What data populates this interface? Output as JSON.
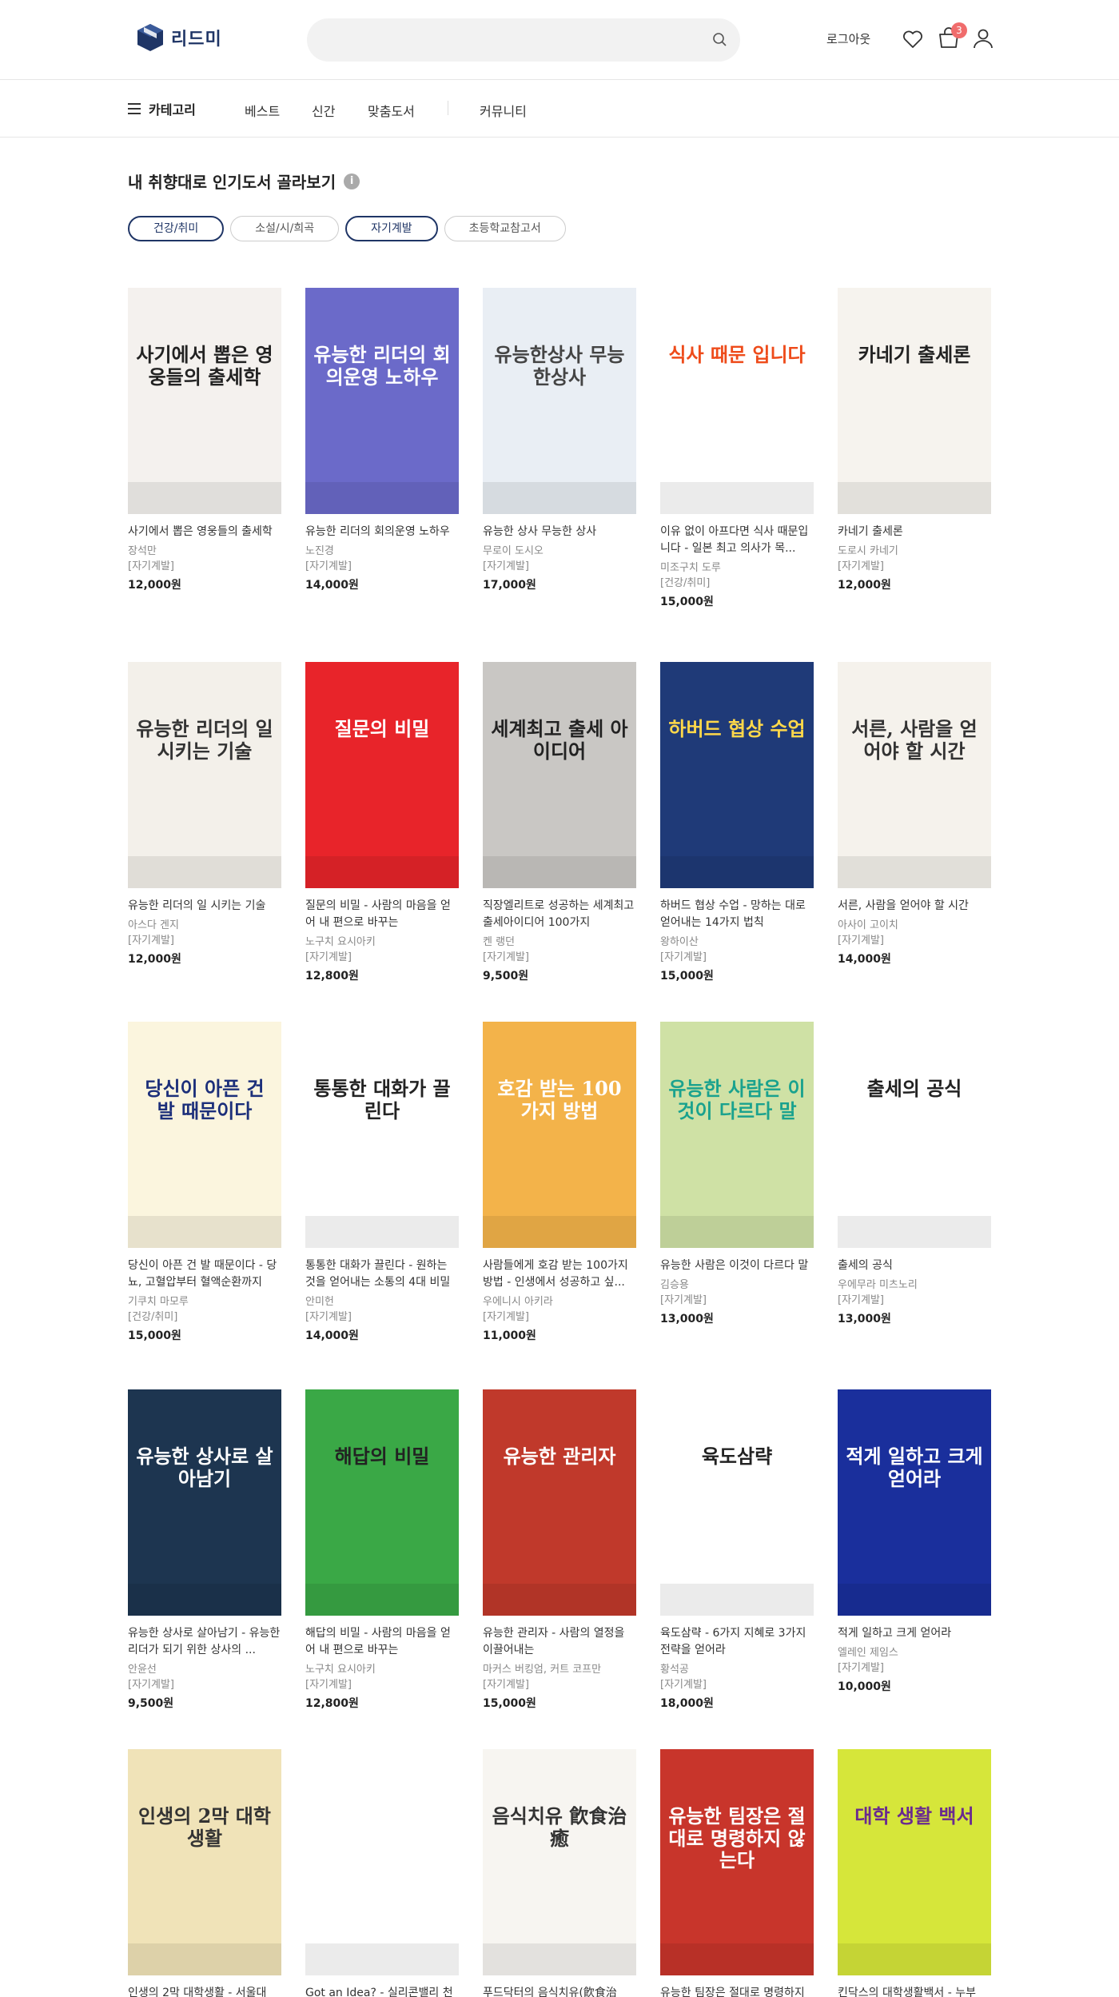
{
  "header": {
    "logo_text": "리드미",
    "search_placeholder": "",
    "login_label": "로그아웃",
    "cart_count": "3"
  },
  "nav": {
    "category_label": "카테고리",
    "links": [
      "베스트",
      "신간",
      "맞춤도서",
      "커뮤니티"
    ]
  },
  "section": {
    "title": "내 취향대로 인기도서 골라보기",
    "info_icon": "i",
    "filters": [
      {
        "label": "건강/취미",
        "active": true
      },
      {
        "label": "소설/시/희곡",
        "active": false
      },
      {
        "label": "자기계발",
        "active": true
      },
      {
        "label": "초등학교참고서",
        "active": false
      }
    ]
  },
  "books": [
    {
      "title": "사기에서 뽑은 영웅들의 출세학",
      "author": "장석만",
      "genre": "[자기계발]",
      "price": "12,000원",
      "cover_text": "사기에서 뽑은 영웅들의 출세학",
      "cover_bg": "#f4f1ee",
      "cover_fg": "#222222"
    },
    {
      "title": "유능한 리더의 회의운영 노하우",
      "author": "노진경",
      "genre": "[자기계발]",
      "price": "14,000원",
      "cover_text": "유능한 리더의 회의운영 노하우",
      "cover_bg": "#6b6ac9",
      "cover_fg": "#ffffff"
    },
    {
      "title": "유능한 상사 무능한 상사",
      "author": "무로이 도시오",
      "genre": "[자기계발]",
      "price": "17,000원",
      "cover_text": "유능한상사 무능한상사",
      "cover_bg": "#e9eef4",
      "cover_fg": "#444444"
    },
    {
      "title": "이유 없이 아프다면 식사 때문입니다 - 일본 최고 의사가 목...",
      "author": "미조구치 도루",
      "genre": "[건강/취미]",
      "price": "15,000원",
      "cover_text": "식사 때문 입니다",
      "cover_bg": "#ffffff",
      "cover_fg": "#ee4b1a"
    },
    {
      "title": "카네기 출세론",
      "author": "도로시 카네기",
      "genre": "[자기계발]",
      "price": "12,000원",
      "cover_text": "카네기 출세론",
      "cover_bg": "#f6f3ee",
      "cover_fg": "#222222"
    },
    {
      "title": "유능한 리더의 일 시키는 기술",
      "author": "아스다 겐지",
      "genre": "[자기계발]",
      "price": "12,000원",
      "cover_text": "유능한 리더의 일 시키는 기술",
      "cover_bg": "#f3f0ea",
      "cover_fg": "#333333"
    },
    {
      "title": "질문의 비밀 - 사람의 마음을 얻어 내 편으로 바꾸는",
      "author": "노구치 요시아키",
      "genre": "[자기계발]",
      "price": "12,800원",
      "cover_text": "질문의 비밀",
      "cover_bg": "#e8242a",
      "cover_fg": "#ffffff"
    },
    {
      "title": "직장엘리트로 성공하는 세계최고 출세아이디어 100가지",
      "author": "켄 랭던",
      "genre": "[자기계발]",
      "price": "9,500원",
      "cover_text": "세계최고 출세 아이디어",
      "cover_bg": "#c9c7c4",
      "cover_fg": "#222222"
    },
    {
      "title": "하버드 협상 수업 - 망하는 대로 얻어내는 14가지 법칙",
      "author": "왕하이산",
      "genre": "[자기계발]",
      "price": "15,000원",
      "cover_text": "하버드 협상 수업",
      "cover_bg": "#1f3a78",
      "cover_fg": "#ffd84a"
    },
    {
      "title": "서른, 사람을 얻어야 할 시간",
      "author": "아사이 고이치",
      "genre": "[자기계발]",
      "price": "14,000원",
      "cover_text": "서른, 사람을 얻어야 할 시간",
      "cover_bg": "#f5f2ec",
      "cover_fg": "#333333"
    },
    {
      "title": "당신이 아픈 건 발 때문이다 - 당뇨, 고혈압부터 혈액순환까지",
      "author": "기쿠치 마모루",
      "genre": "[건강/취미]",
      "price": "15,000원",
      "cover_text": "당신이 아픈 건 발 때문이다",
      "cover_bg": "#fbf5de",
      "cover_fg": "#1c2f7a"
    },
    {
      "title": "통통한 대화가 끌린다 - 원하는 것을 얻어내는 소통의 4대 비밀",
      "author": "안미헌",
      "genre": "[자기계발]",
      "price": "14,000원",
      "cover_text": "통통한 대화가 끌린다",
      "cover_bg": "#ffffff",
      "cover_fg": "#222222"
    },
    {
      "title": "사람들에게 호감 받는 100가지 방법 - 인생에서 성공하고 싶...",
      "author": "우에니시 아키라",
      "genre": "[자기계발]",
      "price": "11,000원",
      "cover_text": "호감 받는 100가지 방법",
      "cover_bg": "#f3b34a",
      "cover_fg": "#ffffff"
    },
    {
      "title": "유능한 사람은 이것이 다르다 말",
      "author": "김승용",
      "genre": "[자기계발]",
      "price": "13,000원",
      "cover_text": "유능한 사람은 이것이 다르다 말",
      "cover_bg": "#cfe1a5",
      "cover_fg": "#1aa28e"
    },
    {
      "title": "출세의 공식",
      "author": "우에무라 미츠노리",
      "genre": "[자기계발]",
      "price": "13,000원",
      "cover_text": "출세의 공식",
      "cover_bg": "#ffffff",
      "cover_fg": "#222222"
    },
    {
      "title": "유능한 상사로 살아남기 - 유능한 리더가 되기 위한 상사의 ...",
      "author": "안윤선",
      "genre": "[자기계발]",
      "price": "9,500원",
      "cover_text": "유능한 상사로 살아남기",
      "cover_bg": "#1d3550",
      "cover_fg": "#ffffff"
    },
    {
      "title": "해답의 비밀 - 사람의 마음을 얻어 내 편으로 바꾸는",
      "author": "노구치 요시아키",
      "genre": "[자기계발]",
      "price": "12,800원",
      "cover_text": "해답의 비밀",
      "cover_bg": "#3aa846",
      "cover_fg": "#222222"
    },
    {
      "title": "유능한 관리자 - 사람의 열정을 이끌어내는",
      "author": "마커스 버킹엄, 커트 코프만",
      "genre": "[자기계발]",
      "price": "15,000원",
      "cover_text": "유능한 관리자",
      "cover_bg": "#c0392b",
      "cover_fg": "#ffffff"
    },
    {
      "title": "육도삼략 - 6가지 지혜로 3가지 전략을 얻어라",
      "author": "황석공",
      "genre": "[자기계발]",
      "price": "18,000원",
      "cover_text": "육도삼략",
      "cover_bg": "#ffffff",
      "cover_fg": "#222222"
    },
    {
      "title": "적게 일하고 크게 얻어라",
      "author": "엘레인 제임스",
      "genre": "[자기계발]",
      "price": "10,000원",
      "cover_text": "적게 일하고 크게 얻어라",
      "cover_bg": "#1a2f9c",
      "cover_fg": "#ffffff"
    },
    {
      "title": "인생의 2막 대학생활 - 서울대",
      "author": "",
      "genre": "",
      "price": "",
      "cover_text": "인생의 2막 대학생활",
      "cover_bg": "#f0e3b8",
      "cover_fg": "#333333"
    },
    {
      "title": "Got an Idea? - 실리콘밸리 천",
      "author": "",
      "genre": "",
      "price": "",
      "cover_text": "",
      "cover_bg": "#ffffff",
      "cover_fg": "#ffffff"
    },
    {
      "title": "푸드닥터의 음식치유(飮食治",
      "author": "",
      "genre": "",
      "price": "",
      "cover_text": "음식치유 飮食治癒",
      "cover_bg": "#f7f5f1",
      "cover_fg": "#333333"
    },
    {
      "title": "유능한 팀장은 절대로 명령하지",
      "author": "",
      "genre": "",
      "price": "",
      "cover_text": "유능한 팀장은 절대로 명령하지 않는다",
      "cover_bg": "#c8352b",
      "cover_fg": "#ffffff"
    },
    {
      "title": "킨닥스의 대학생활백서 - 누부",
      "author": "",
      "genre": "",
      "price": "",
      "cover_text": "대학 생활 백서",
      "cover_bg": "#d6e63a",
      "cover_fg": "#6a2a8f"
    }
  ]
}
